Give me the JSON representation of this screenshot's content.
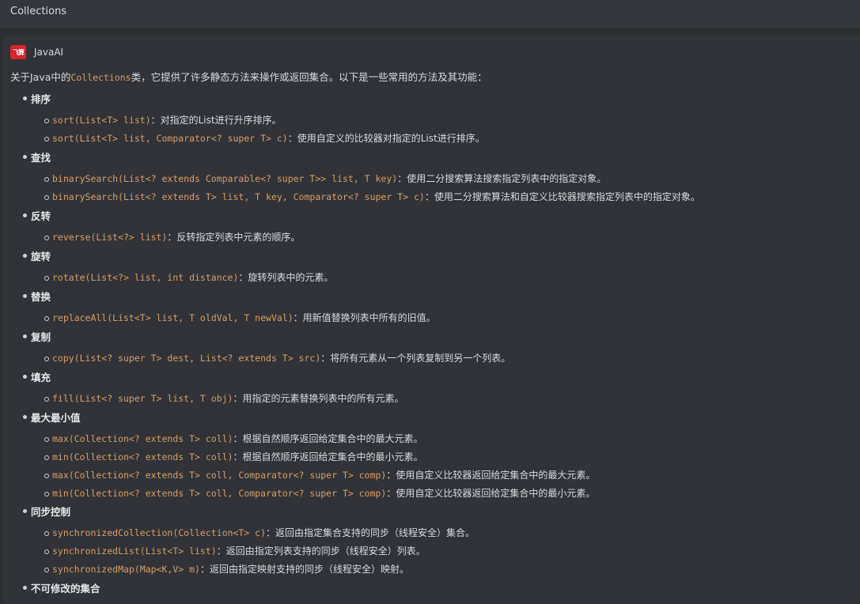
{
  "window": {
    "title": "Collections"
  },
  "message": {
    "sender": "JavaAI",
    "logo_text": "飞算",
    "intro_prefix": "关于Java中的",
    "intro_code": "Collections",
    "intro_suffix": "类，它提供了许多静态方法来操作或返回集合。以下是一些常用的方法及其功能："
  },
  "sections": [
    {
      "title": "排序",
      "items": [
        {
          "code": "sort(List<T> list)",
          "desc": "：对指定的List进行升序排序。"
        },
        {
          "code": "sort(List<T> list, Comparator<? super T> c)",
          "desc": "：使用自定义的比较器对指定的List进行排序。"
        }
      ]
    },
    {
      "title": "查找",
      "items": [
        {
          "code": "binarySearch(List<? extends Comparable<? super T>> list, T key)",
          "desc": "：使用二分搜索算法搜索指定列表中的指定对象。"
        },
        {
          "code": "binarySearch(List<? extends T> list, T key, Comparator<? super T> c)",
          "desc": "：使用二分搜索算法和自定义比较器搜索指定列表中的指定对象。"
        }
      ]
    },
    {
      "title": "反转",
      "items": [
        {
          "code": "reverse(List<?> list)",
          "desc": "：反转指定列表中元素的顺序。"
        }
      ]
    },
    {
      "title": "旋转",
      "items": [
        {
          "code": "rotate(List<?> list, int distance)",
          "desc": "：旋转列表中的元素。"
        }
      ]
    },
    {
      "title": "替换",
      "items": [
        {
          "code": "replaceAll(List<T> list, T oldVal, T newVal)",
          "desc": "：用新值替换列表中所有的旧值。"
        }
      ]
    },
    {
      "title": "复制",
      "items": [
        {
          "code": "copy(List<? super T> dest, List<? extends T> src)",
          "desc": "：将所有元素从一个列表复制到另一个列表。"
        }
      ]
    },
    {
      "title": "填充",
      "items": [
        {
          "code": "fill(List<? super T> list, T obj)",
          "desc": "：用指定的元素替换列表中的所有元素。"
        }
      ]
    },
    {
      "title": "最大最小值",
      "items": [
        {
          "code": "max(Collection<? extends T> coll)",
          "desc": "：根据自然顺序返回给定集合中的最大元素。"
        },
        {
          "code": "min(Collection<? extends T> coll)",
          "desc": "：根据自然顺序返回给定集合中的最小元素。"
        },
        {
          "code": "max(Collection<? extends T> coll, Comparator<? super T> comp)",
          "desc": "：使用自定义比较器返回给定集合中的最大元素。"
        },
        {
          "code": "min(Collection<? extends T> coll, Comparator<? super T> comp)",
          "desc": "：使用自定义比较器返回给定集合中的最小元素。"
        }
      ]
    },
    {
      "title": "同步控制",
      "items": [
        {
          "code": "synchronizedCollection(Collection<T> c)",
          "desc": "：返回由指定集合支持的同步（线程安全）集合。"
        },
        {
          "code": "synchronizedList(List<T> list)",
          "desc": "：返回由指定列表支持的同步（线程安全）列表。"
        },
        {
          "code": "synchronizedMap(Map<K,V> m)",
          "desc": "：返回由指定映射支持的同步（线程安全）映射。"
        }
      ]
    },
    {
      "title": "不可修改的集合",
      "items": []
    }
  ]
}
